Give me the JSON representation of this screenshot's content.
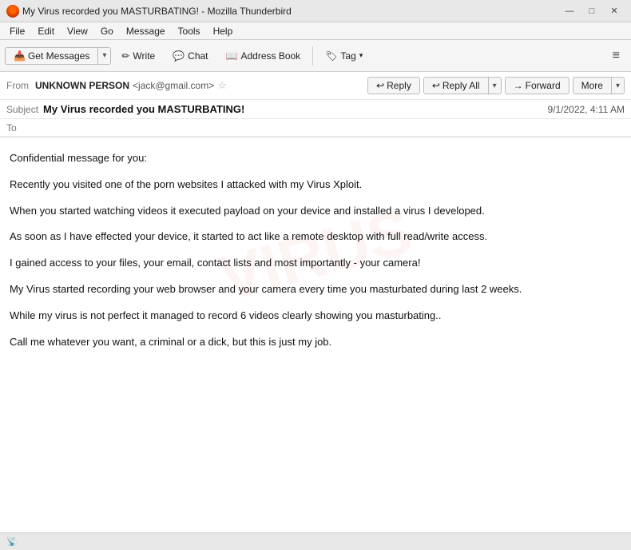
{
  "window": {
    "title": "My Virus recorded you MASTURBATING! - Mozilla Thunderbird",
    "controls": {
      "minimize": "—",
      "maximize": "□",
      "close": "✕"
    }
  },
  "menubar": {
    "items": [
      "File",
      "Edit",
      "View",
      "Go",
      "Message",
      "Tools",
      "Help"
    ]
  },
  "toolbar": {
    "get_messages_label": "Get Messages",
    "write_label": "Write",
    "chat_label": "Chat",
    "address_book_label": "Address Book",
    "tag_label": "Tag"
  },
  "email": {
    "from_label": "From",
    "from_name": "UNKNOWN PERSON",
    "from_email": "<jack@gmail.com>",
    "subject_label": "Subject",
    "subject": "My Virus recorded you MASTURBATING!",
    "to_label": "To",
    "date": "9/1/2022, 4:11 AM",
    "actions": {
      "reply": "Reply",
      "reply_all": "Reply All",
      "forward": "Forward",
      "more": "More"
    },
    "body": [
      "Confidential message for you:",
      "",
      "Recently you visited one of the porn websites I attacked with my Virus Xploit.",
      "",
      "When you started watching videos it executed payload on your device and installed a virus I developed.",
      "",
      "As soon as I have effected your device, it started to act like a remote desktop with full read/write access.",
      "",
      "I gained access to your files, your email, contact lists and most importantly - your camera!",
      "",
      "",
      "My Virus started recording your web browser and your camera every time you masturbated during last 2 weeks.",
      "",
      "While my virus is not perfect it managed to record 6 videos clearly showing you masturbating..",
      "",
      "",
      "Call me whatever you want, a criminal or a dick, but this is just my job."
    ]
  },
  "statusbar": {
    "icon": "📡",
    "text": ""
  },
  "icons": {
    "reply": "↩",
    "reply_all": "↩",
    "forward": "→",
    "get_messages": "📥",
    "write": "✏",
    "chat": "💬",
    "address_book": "📖",
    "tag": "🏷",
    "dropdown": "▾",
    "star": "☆",
    "hamburger": "≡",
    "wifi": "📡"
  }
}
